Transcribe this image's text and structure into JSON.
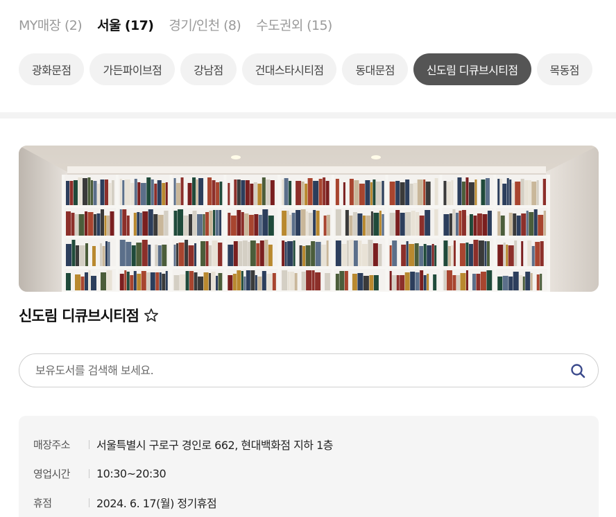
{
  "region_tabs": [
    {
      "label": "MY매장 (2)",
      "active": false
    },
    {
      "label": "서울 (17)",
      "active": true
    },
    {
      "label": "경기/인천 (8)",
      "active": false
    },
    {
      "label": "수도권외 (15)",
      "active": false
    }
  ],
  "store_chips": [
    {
      "label": "광화문점",
      "active": false
    },
    {
      "label": "가든파이브점",
      "active": false
    },
    {
      "label": "강남점",
      "active": false
    },
    {
      "label": "건대스타시티점",
      "active": false
    },
    {
      "label": "동대문점",
      "active": false
    },
    {
      "label": "신도림 디큐브시티점",
      "active": true
    },
    {
      "label": "목동점",
      "active": false
    }
  ],
  "store": {
    "name": "신도림 디큐브시티점",
    "favorite_icon": "star-outline-icon"
  },
  "search": {
    "placeholder": "보유도서를 검색해 보세요.",
    "value": "",
    "icon": "search-icon",
    "icon_color": "#3b4a8c"
  },
  "info": [
    {
      "label": "매장주소",
      "value": "서울특별시 구로구 경인로 662, 현대백화점 지하 1층"
    },
    {
      "label": "영업시간",
      "value": "10:30~20:30"
    },
    {
      "label": "휴점",
      "value": "2024. 6. 17(월) 정기휴점"
    }
  ],
  "colors": {
    "active_chip_bg": "#555555",
    "chip_bg": "#f2f2f2",
    "panel_bg": "#f5f5f5",
    "inactive_tab_text": "#9a9a9a"
  }
}
